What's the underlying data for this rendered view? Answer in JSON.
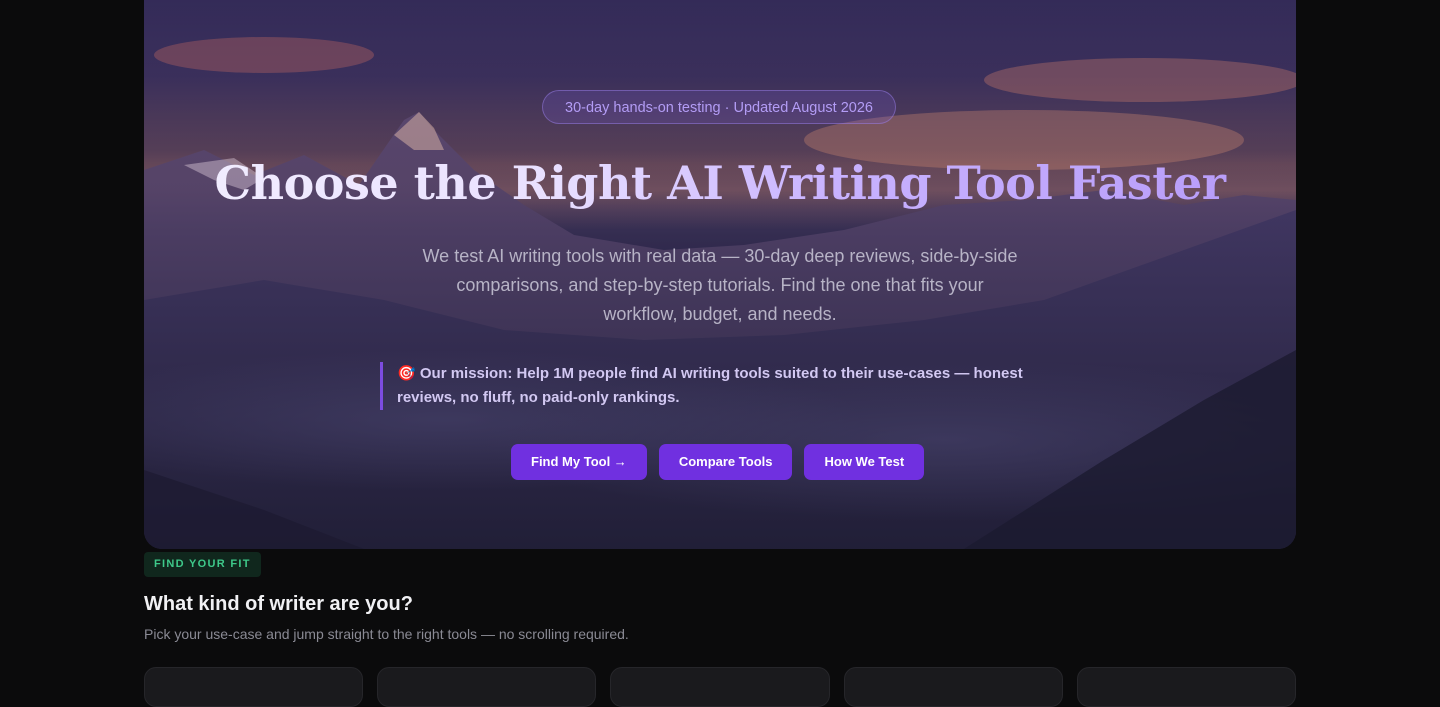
{
  "hero": {
    "badge": "30-day hands-on testing · Updated August 2026",
    "title": "Choose the Right AI Writing Tool Faster",
    "subtitle": "We test AI writing tools with real data — 30-day deep reviews, side-by-side comparisons, and step-by-step tutorials. Find the one that fits your workflow, budget, and needs.",
    "mission_icon": "🎯",
    "mission": "Our mission: Help 1M people find AI writing tools suited to their use-cases — honest reviews, no fluff, no paid-only rankings.",
    "buttons": [
      {
        "label": "Find My Tool →"
      },
      {
        "label": "Compare Tools"
      },
      {
        "label": "How We Test"
      }
    ],
    "accent_color": "#7030e0"
  },
  "fit_section": {
    "eyebrow": "FIND YOUR FIT",
    "heading": "What kind of writer are you?",
    "description": "Pick your use-case and jump straight to the right tools — no scrolling required."
  }
}
